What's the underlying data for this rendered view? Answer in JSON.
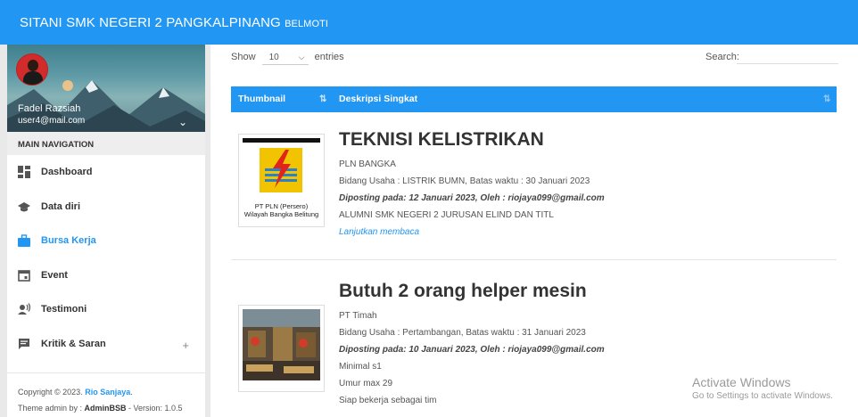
{
  "header": {
    "brand_main": "SITANI SMK NEGERI 2 PANGKALPINANG",
    "brand_small": "BELMOTI"
  },
  "user": {
    "name": "Fadel Razsiah",
    "email": "user4@mail.com"
  },
  "sidebar": {
    "nav_header": "MAIN NAVIGATION",
    "items": [
      {
        "label": "Dashboard",
        "icon": "dashboard-icon"
      },
      {
        "label": "Data diri",
        "icon": "school-icon"
      },
      {
        "label": "Bursa Kerja",
        "icon": "briefcase-icon",
        "active": true
      },
      {
        "label": "Event",
        "icon": "calendar-icon"
      },
      {
        "label": "Testimoni",
        "icon": "speaker-person-icon"
      },
      {
        "label": "Kritik & Saran",
        "icon": "message-icon",
        "expand": "+"
      }
    ]
  },
  "footer": {
    "copyright": "Copyright © 2023.",
    "author": "Rio Sanjaya",
    "period": ".",
    "theme_prefix": "Theme admin by : ",
    "theme_name": "AdminBSB",
    "version": " - Version: 1.0.5"
  },
  "table_controls": {
    "show_label": "Show",
    "entries_value": "10",
    "entries_label": "entries",
    "search_label": "Search:"
  },
  "table": {
    "columns": [
      "Thumbnail",
      "Deskripsi Singkat"
    ],
    "rows": [
      {
        "thumb_caption_1": "PT PLN (Persero)",
        "thumb_caption_2": "Wilayah Bangka Belitung",
        "title": "TEKNISI KELISTRIKAN",
        "company": "PLN BANGKA",
        "bidang": "Bidang Usaha : LISTRIK BUMN, Batas waktu : 30 Januari 2023",
        "posted": "Diposting pada: 12 Januari 2023, Oleh : riojaya099@gmail.com",
        "note": "ALUMNI SMK NEGERI 2 JURUSAN ELIND DAN TITL",
        "more": "Lanjutkan membaca"
      },
      {
        "title": "Butuh 2 orang helper mesin",
        "company": "PT Timah",
        "bidang": "Bidang Usaha : Pertambangan, Batas waktu : 31 Januari 2023",
        "posted": "Diposting pada: 10 Januari 2023, Oleh : riojaya099@gmail.com",
        "req1": "Minimal s1",
        "req2": "Umur max 29",
        "req3": "Siap bekerja sebagai tim"
      }
    ]
  },
  "watermark": {
    "line1": "Activate Windows",
    "line2": "Go to Settings to activate Windows."
  }
}
